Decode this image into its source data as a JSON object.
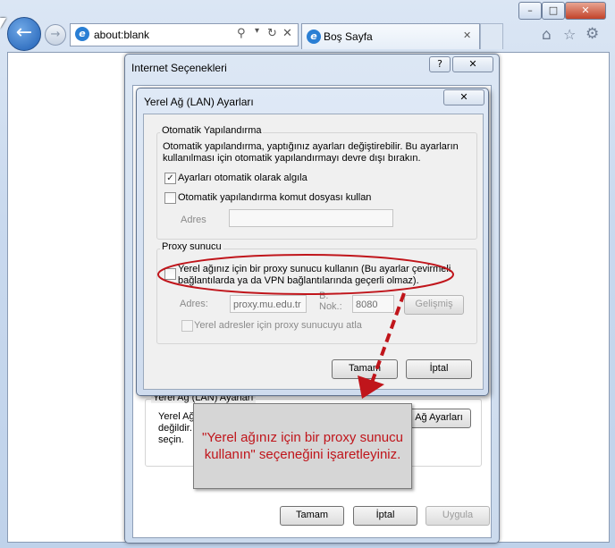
{
  "browser": {
    "address": "about:blank",
    "tab_title": "Boş Sayfa",
    "window_controls": {
      "minimize": "–",
      "maximize": "□",
      "close": "✕"
    }
  },
  "internet_options": {
    "title": "Internet Seçenekleri",
    "help": "?",
    "lan_section_label": "Yerel Ağ (LAN) Ayarları",
    "lan_text": [
      "Yerel Ağ",
      "değildir.",
      "seçin."
    ],
    "lan_button": "Ağ Ayarları",
    "ok": "Tamam",
    "cancel": "İptal",
    "apply": "Uygula"
  },
  "lan_dialog": {
    "title": "Yerel Ağ (LAN) Ayarları",
    "auto_group": "Otomatik Yapılandırma",
    "auto_desc": [
      "Otomatik yapılandırma, yaptığınız ayarları değiştirebilir. Bu ayarların",
      "kullanılması için otomatik yapılandırmayı devre dışı bırakın."
    ],
    "auto_detect_label": "Ayarları otomatik olarak algıla",
    "auto_detect_checked": true,
    "auto_script_label": "Otomatik yapılandırma komut dosyası kullan",
    "auto_script_checked": false,
    "address_label": "Adres",
    "proxy_group": "Proxy sunucu",
    "proxy_use_label": [
      "Yerel ağınız için bir proxy sunucu kullanın (Bu ayarlar çevirmeli",
      "bağlantılarda ya da VPN bağlantılarında geçerli olmaz)."
    ],
    "proxy_use_checked": false,
    "proxy_address_label": "Adres:",
    "proxy_address_value": "proxy.mu.edu.tr",
    "port_label": [
      "B.",
      "Nok.:"
    ],
    "port_value": "8080",
    "advanced_button": "Gelişmiş",
    "bypass_label": "Yerel adresler için proxy sunucuyu atla",
    "ok": "Tamam",
    "cancel": "İptal",
    "close": "✕"
  },
  "callout": {
    "lines": [
      "\"Yerel ağınız için bir proxy sunucu",
      "kullanın\" seçeneğini işaretleyiniz."
    ],
    "color": "#c0151b"
  },
  "colors": {
    "annotation_red": "#c0151b",
    "annotation_bg": "#d6d6d6"
  }
}
